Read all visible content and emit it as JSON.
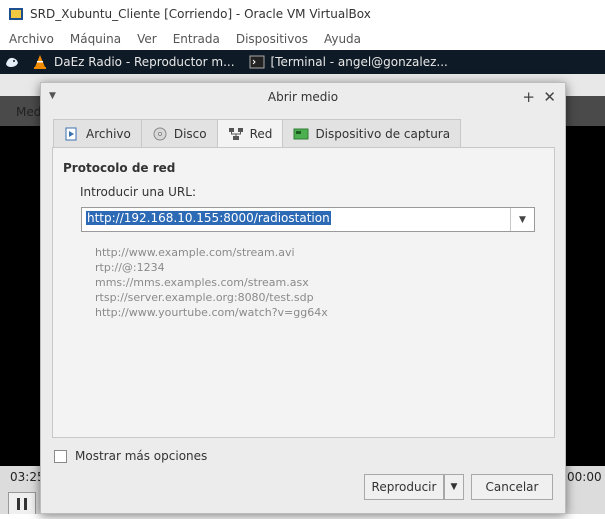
{
  "host": {
    "title": "SRD_Xubuntu_Cliente [Corriendo] - Oracle VM VirtualBox",
    "menu": [
      "Archivo",
      "Máquina",
      "Ver",
      "Entrada",
      "Dispositivos",
      "Ayuda"
    ]
  },
  "panel": {
    "tasks": [
      {
        "label": "DaEz Radio - Reproductor m...",
        "icon": "vlc-cone-icon"
      },
      {
        "label": "[Terminal - angel@gonzalez...",
        "icon": "terminal-icon"
      }
    ]
  },
  "vlc": {
    "menu_fragment": "Med",
    "time_elapsed": "03:25",
    "time_total": "00:00"
  },
  "dialog": {
    "title": "Abrir medio",
    "tabs": [
      {
        "label": "Archivo",
        "icon": "file-play-icon"
      },
      {
        "label": "Disco",
        "icon": "disc-icon"
      },
      {
        "label": "Red",
        "icon": "network-icon"
      },
      {
        "label": "Dispositivo de captura",
        "icon": "capture-card-icon"
      }
    ],
    "active_tab": "Red",
    "section_title": "Protocolo de red",
    "url_label": "Introducir una URL:",
    "url_value": "http://192.168.10.155:8000/radiostation",
    "examples": [
      "http://www.example.com/stream.avi",
      "rtp://@:1234",
      "mms://mms.examples.com/stream.asx",
      "rtsp://server.example.org:8080/test.sdp",
      "http://www.yourtube.com/watch?v=gg64x"
    ],
    "more_options": "Mostrar más opciones",
    "play_button": "Reproducir",
    "cancel_button": "Cancelar"
  }
}
